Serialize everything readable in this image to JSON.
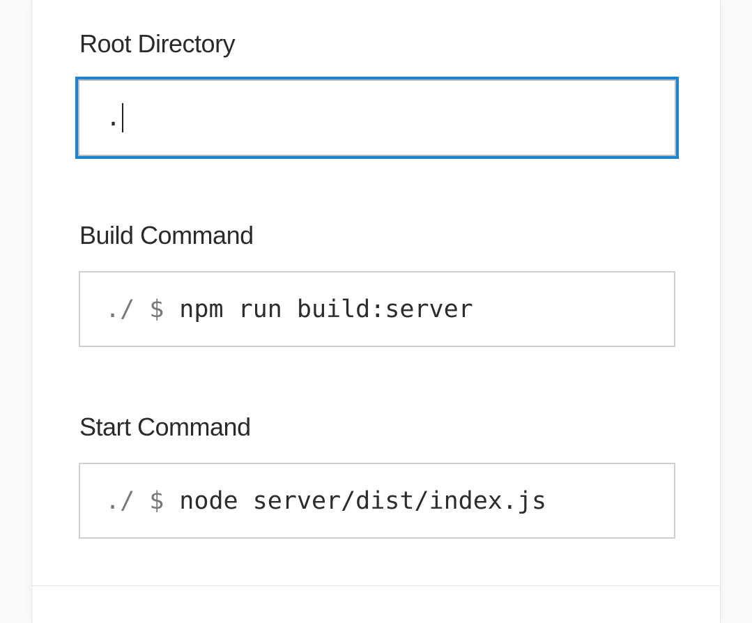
{
  "root_directory": {
    "label": "Root Directory",
    "value": "."
  },
  "build_command": {
    "label": "Build Command",
    "prefix": "./ $",
    "value": "npm run build:server"
  },
  "start_command": {
    "label": "Start Command",
    "prefix": "./ $",
    "value": "node server/dist/index.js"
  },
  "colors": {
    "focus_border": "#1a84d6",
    "label_text": "#2a2a2a",
    "prefix_text": "#777777",
    "field_border": "#cfcfcf"
  }
}
